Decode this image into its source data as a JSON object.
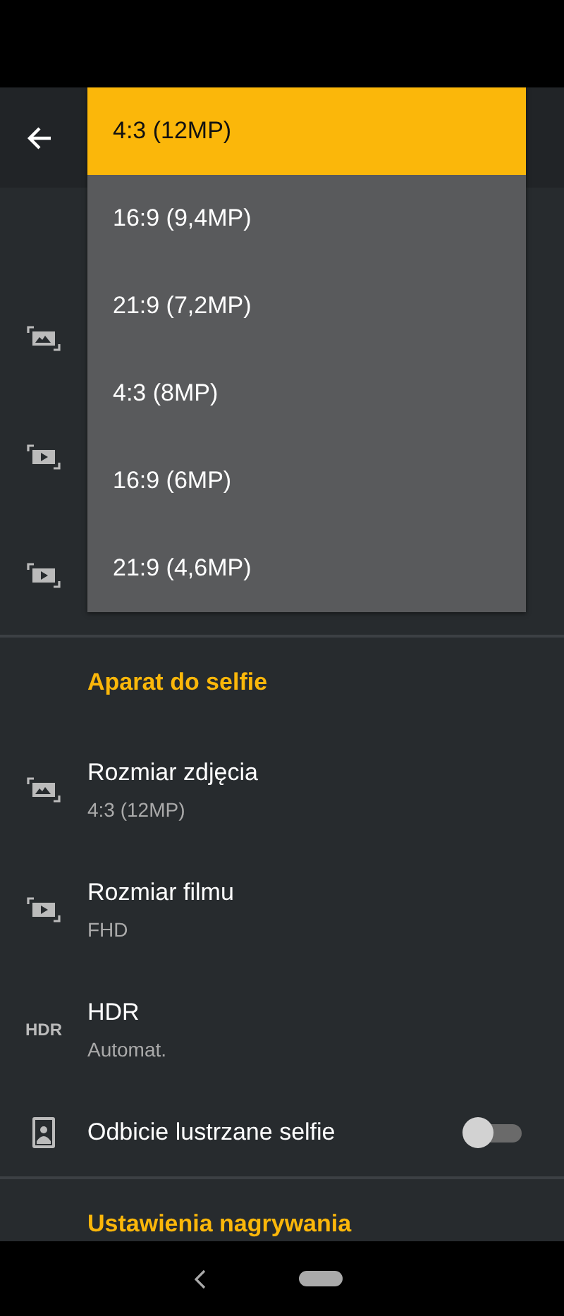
{
  "camera_rows": [
    {
      "kind": "photo"
    },
    {
      "kind": "video"
    },
    {
      "kind": "video"
    }
  ],
  "sections": [
    {
      "title": "Aparat do selfie",
      "rows": [
        {
          "kind": "photo",
          "label": "Rozmiar zdjęcia",
          "value": "4:3 (12MP)"
        },
        {
          "kind": "video",
          "label": "Rozmiar filmu",
          "value": "FHD"
        },
        {
          "kind": "hdr",
          "icon_text": "HDR",
          "label": "HDR",
          "value": "Automat."
        },
        {
          "kind": "mirror",
          "label": "Odbicie lustrzane selfie",
          "on": false
        }
      ]
    },
    {
      "title": "Ustawienia nagrywania"
    }
  ],
  "dropdown": {
    "options": [
      {
        "label": "4:3 (12MP)",
        "selected": true
      },
      {
        "label": "16:9 (9,4MP)",
        "selected": false
      },
      {
        "label": "21:9 (7,2MP)",
        "selected": false
      },
      {
        "label": "4:3 (8MP)",
        "selected": false
      },
      {
        "label": "16:9 (6MP)",
        "selected": false
      },
      {
        "label": "21:9 (4,6MP)",
        "selected": false
      }
    ]
  }
}
